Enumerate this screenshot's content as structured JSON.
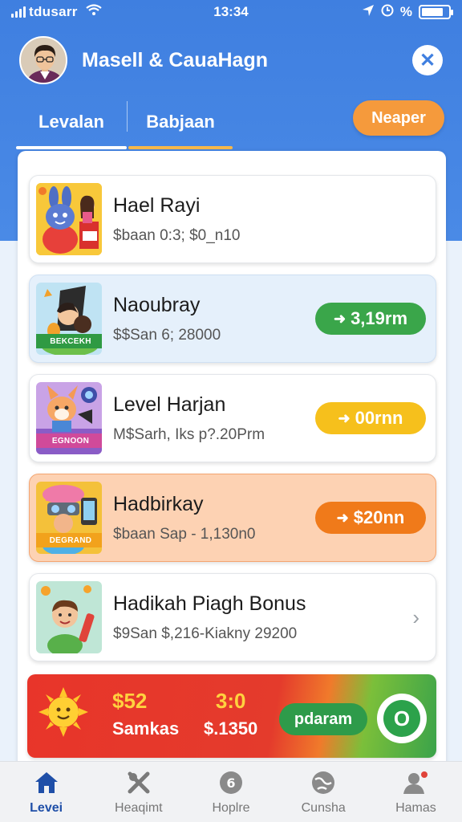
{
  "status_bar": {
    "carrier": "tdusarr",
    "time": "13:34",
    "battery_text": "%",
    "battery_percent": 80
  },
  "profile": {
    "name": "Masell & CauaHagn"
  },
  "tabs": [
    {
      "label": "Levalan",
      "active": false
    },
    {
      "label": "Babjaan",
      "active": true
    }
  ],
  "top_action": {
    "label": "Neaper"
  },
  "cards": [
    {
      "title": "Hael Rayi",
      "subtitle": "$baan 0:3; $0_n10",
      "style": "white"
    },
    {
      "title": "Naoubray",
      "subtitle": "$$San 6; 28000",
      "style": "blue",
      "banner": "BEKCEKH",
      "pill": {
        "label": "3,19rm",
        "color": "#3aa64a"
      }
    },
    {
      "title": "Level Harjan",
      "subtitle": "M$Sarh, Iks p?.20Prm",
      "style": "white",
      "banner": "EGNOON",
      "pill": {
        "label": "00rnn",
        "color": "#f6c01c"
      }
    },
    {
      "title": "Hadbirkay",
      "subtitle": "$baan Sap - 1,130n0",
      "style": "orange",
      "banner": "DEGRAND",
      "pill": {
        "label": "$20nn",
        "color": "#f07a1a"
      }
    },
    {
      "title": "Hadikah Piagh Bonus",
      "subtitle": "$9San $,216-Kiakny 29200",
      "style": "white"
    }
  ],
  "promo": {
    "amount_left": "$52",
    "label_left": "Samkas",
    "amount_right": "3:0",
    "label_right": "$.1350",
    "button": "pdaram",
    "ring": "O"
  },
  "bottom_nav": [
    {
      "label": "Levei",
      "icon": "home-icon",
      "active": true
    },
    {
      "label": "Heaqimt",
      "icon": "crossed-tools-icon",
      "active": false
    },
    {
      "label": "Hoplre",
      "icon": "coin-icon",
      "active": false
    },
    {
      "label": "Cunsha",
      "icon": "globe-icon",
      "active": false
    },
    {
      "label": "Hamas",
      "icon": "profile-icon",
      "active": false
    }
  ],
  "colors": {
    "header": "#3f7fe0",
    "accent_orange": "#f59a3c",
    "active_nav": "#1f4fa8"
  }
}
